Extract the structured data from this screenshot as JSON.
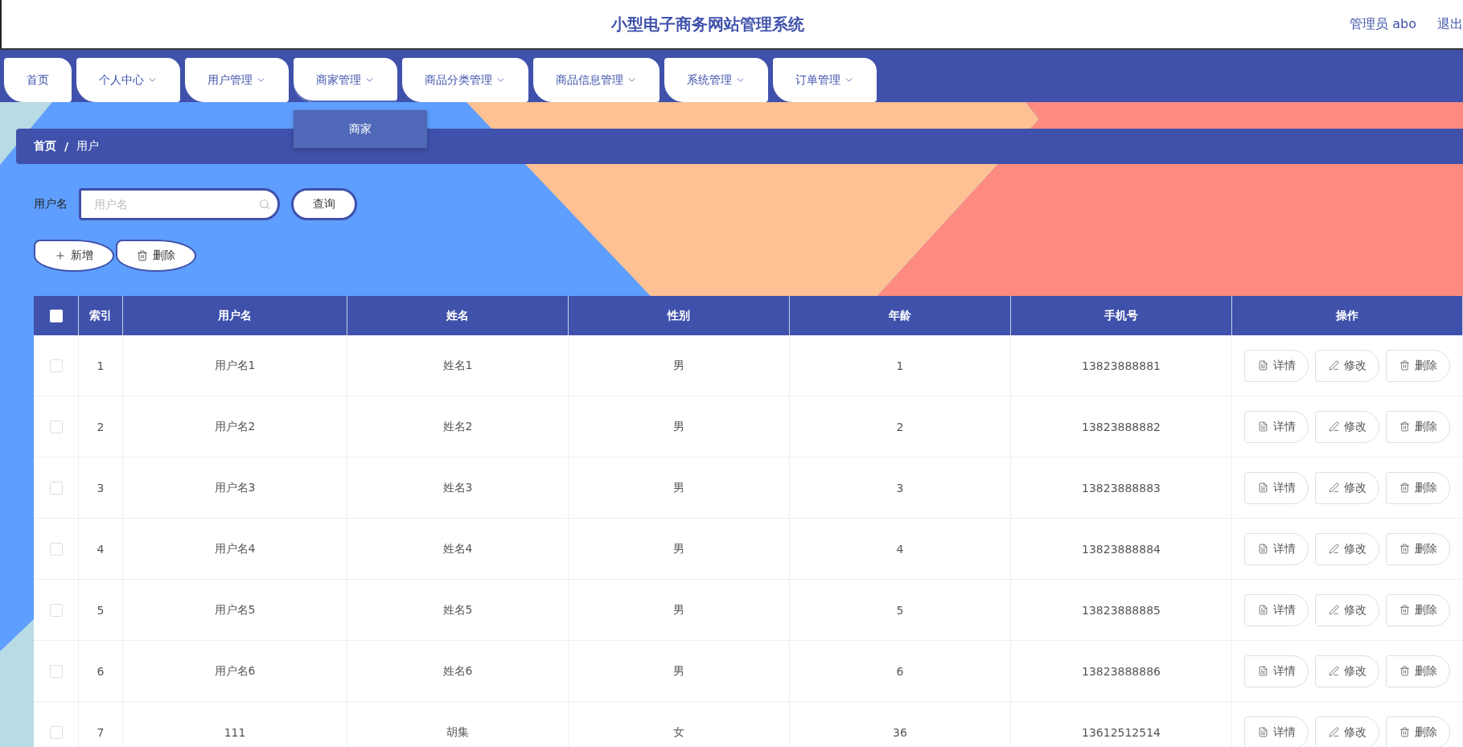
{
  "header": {
    "title": "小型电子商务网站管理系统",
    "user": "管理员 abo",
    "logout": "退出"
  },
  "nav": [
    {
      "label": "首页",
      "caret": false,
      "expanded": false
    },
    {
      "label": "个人中心",
      "caret": true,
      "expanded": false
    },
    {
      "label": "用户管理",
      "caret": true,
      "expanded": false
    },
    {
      "label": "商家管理",
      "caret": true,
      "expanded": true,
      "submenu": [
        "商家"
      ]
    },
    {
      "label": "商品分类管理",
      "caret": true,
      "expanded": false
    },
    {
      "label": "商品信息管理",
      "caret": true,
      "expanded": false
    },
    {
      "label": "系统管理",
      "caret": true,
      "expanded": false
    },
    {
      "label": "订单管理",
      "caret": true,
      "expanded": false
    }
  ],
  "breadcrumb": {
    "items": [
      "首页",
      "用户"
    ],
    "separator": "/"
  },
  "search": {
    "label": "用户名",
    "placeholder": "用户名",
    "button": "查询"
  },
  "actions": [
    {
      "kind": "add",
      "label": "新增"
    },
    {
      "kind": "delete",
      "label": "删除"
    }
  ],
  "table": {
    "all_checked": false,
    "columns": [
      "索引",
      "用户名",
      "姓名",
      "性别",
      "年龄",
      "手机号",
      "操作"
    ],
    "rows": [
      {
        "checked": false,
        "cells": [
          "1",
          "用户名1",
          "姓名1",
          "男",
          "1",
          "13823888881"
        ],
        "actions": [
          {
            "kind": "detail",
            "label": "详情"
          },
          {
            "kind": "edit",
            "label": "修改"
          },
          {
            "kind": "delete",
            "label": "删除"
          }
        ]
      },
      {
        "checked": false,
        "cells": [
          "2",
          "用户名2",
          "姓名2",
          "男",
          "2",
          "13823888882"
        ],
        "actions": [
          {
            "kind": "detail",
            "label": "详情"
          },
          {
            "kind": "edit",
            "label": "修改"
          },
          {
            "kind": "delete",
            "label": "删除"
          }
        ]
      },
      {
        "checked": false,
        "cells": [
          "3",
          "用户名3",
          "姓名3",
          "男",
          "3",
          "13823888883"
        ],
        "actions": [
          {
            "kind": "detail",
            "label": "详情"
          },
          {
            "kind": "edit",
            "label": "修改"
          },
          {
            "kind": "delete",
            "label": "删除"
          }
        ]
      },
      {
        "checked": false,
        "cells": [
          "4",
          "用户名4",
          "姓名4",
          "男",
          "4",
          "13823888884"
        ],
        "actions": [
          {
            "kind": "detail",
            "label": "详情"
          },
          {
            "kind": "edit",
            "label": "修改"
          },
          {
            "kind": "delete",
            "label": "删除"
          }
        ]
      },
      {
        "checked": false,
        "cells": [
          "5",
          "用户名5",
          "姓名5",
          "男",
          "5",
          "13823888885"
        ],
        "actions": [
          {
            "kind": "detail",
            "label": "详情"
          },
          {
            "kind": "edit",
            "label": "修改"
          },
          {
            "kind": "delete",
            "label": "删除"
          }
        ]
      },
      {
        "checked": false,
        "cells": [
          "6",
          "用户名6",
          "姓名6",
          "男",
          "6",
          "13823888886"
        ],
        "actions": [
          {
            "kind": "detail",
            "label": "详情"
          },
          {
            "kind": "edit",
            "label": "修改"
          },
          {
            "kind": "delete",
            "label": "删除"
          }
        ]
      },
      {
        "checked": false,
        "cells": [
          "7",
          "111",
          "胡集",
          "女",
          "36",
          "13612512514"
        ],
        "actions": [
          {
            "kind": "detail",
            "label": "详情"
          },
          {
            "kind": "edit",
            "label": "修改"
          },
          {
            "kind": "delete",
            "label": "删除"
          }
        ]
      }
    ]
  }
}
